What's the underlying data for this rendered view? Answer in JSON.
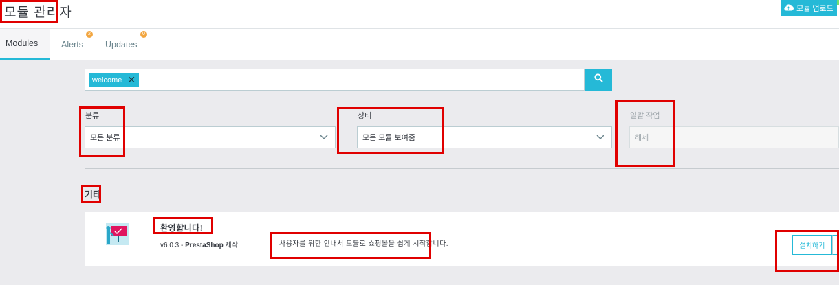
{
  "header": {
    "title": "모듈 관리자",
    "upload_label": "모듈 업로드"
  },
  "tabs": [
    {
      "label": "Modules",
      "active": true
    },
    {
      "label": "Alerts",
      "badge": "2"
    },
    {
      "label": "Updates",
      "badge": "0"
    }
  ],
  "search": {
    "chip_label": "welcome",
    "chip_remove": "✕"
  },
  "filters": {
    "category": {
      "label": "분류",
      "value": "모든 분류"
    },
    "status": {
      "label": "상태",
      "value": "모든 모듈 보여줌"
    },
    "bulk_action": {
      "label": "일괄 작업",
      "value": "해제",
      "disabled": true
    }
  },
  "section": {
    "title": "기타"
  },
  "module": {
    "name": "환영합니다!",
    "version": "v6.0.3",
    "separator": " - ",
    "author": "PrestaShop",
    "author_suffix": "제작",
    "description": "사용자를 위한 안내서 모듈로 쇼핑몰을 쉽게 시작합니다.",
    "install_label": "설치하기"
  },
  "colors": {
    "accent": "#25b9d7",
    "badge": "#f2a640",
    "highlight": "#e00000",
    "background": "#ebebee"
  },
  "icons": [
    "cloud-upload-icon",
    "search-icon",
    "chevron-down-icon",
    "welcome-module-icon"
  ]
}
